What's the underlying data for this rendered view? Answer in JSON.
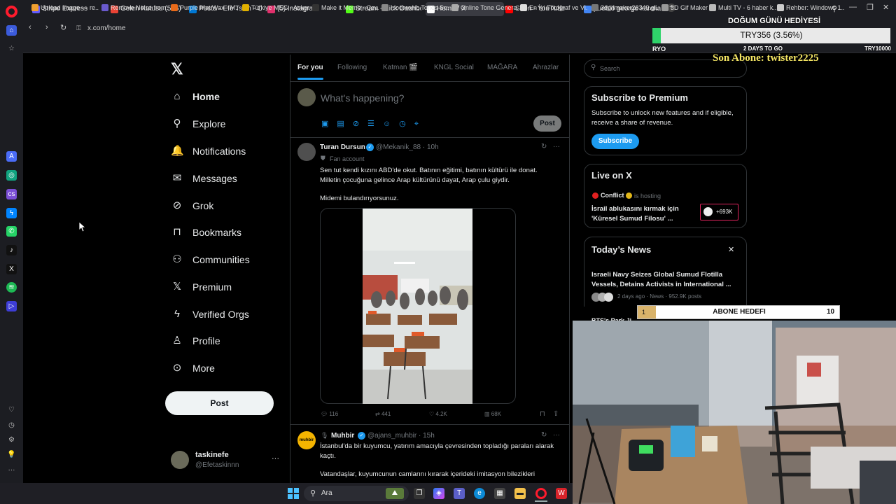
{
  "browser": {
    "tabs": [
      {
        "label": "Stripe Express",
        "icon": "stripe-icon",
        "color": "#635bff"
      },
      {
        "label": "Gelen Kutusu (516) - nosu",
        "icon": "gmail-icon",
        "color": "#ea4335"
      },
      {
        "label": "Posta - Efe Tskin - Outlook",
        "icon": "outlook-icon",
        "color": "#0078d4"
      },
      {
        "label": "(5) Instagram",
        "icon": "instagram-icon",
        "color": "#e1306c"
      },
      {
        "label": "Stream - Kick Dashboard",
        "icon": "kick-icon",
        "color": "#53fc18"
      },
      {
        "label": "Home / X",
        "icon": "x-icon",
        "color": "#ffffff"
      },
      {
        "label": "Siren - YouTube",
        "icon": "youtube-icon",
        "color": "#ff0000"
      },
      {
        "label": "pueblo george karelias - G",
        "icon": "google-icon",
        "color": "#4285f4"
      }
    ],
    "new_tab": "+",
    "url": "x.com/home",
    "bookmarks": [
      {
        "label": "Upload Image — re...",
        "color": "#f0a030"
      },
      {
        "label": "Remove Noise from...",
        "color": "#6a5acd"
      },
      {
        "label": "Purple Mat Wax - M...",
        "color": "#e86a1a"
      },
      {
        "label": "Türkiye MEG - Asker...",
        "color": "#e0b000"
      },
      {
        "label": "Make it Meme - Çev...",
        "color": "#333333"
      },
      {
        "label": "Isochronic Tones So...",
        "color": "#888888"
      },
      {
        "label": "Online Tone Genera...",
        "color": "#aaaaaa"
      },
      {
        "label": "En İyi Fotoğraf ve Vi...",
        "color": "#dddddd"
      },
      {
        "label": "3dgifmaker28349.gi...",
        "color": "#777777"
      },
      {
        "label": "3D Gif Maker",
        "color": "#999999"
      },
      {
        "label": "Multi TV - 6 haber k...",
        "color": "#bbbbbb"
      },
      {
        "label": "Rehber: Windows 1...",
        "color": "#cccccc"
      }
    ]
  },
  "x_nav": {
    "items": [
      {
        "label": "Home",
        "icon": "home-icon",
        "glyph": "⌂",
        "bold": true
      },
      {
        "label": "Explore",
        "icon": "search-icon",
        "glyph": "⚲"
      },
      {
        "label": "Notifications",
        "icon": "bell-icon",
        "glyph": "🔔"
      },
      {
        "label": "Messages",
        "icon": "mail-icon",
        "glyph": "✉"
      },
      {
        "label": "Grok",
        "icon": "grok-icon",
        "glyph": "⊘"
      },
      {
        "label": "Bookmarks",
        "icon": "bookmark-icon",
        "glyph": "⊓"
      },
      {
        "label": "Communities",
        "icon": "communities-icon",
        "glyph": "⚇"
      },
      {
        "label": "Premium",
        "icon": "x-premium-icon",
        "glyph": "𝕏"
      },
      {
        "label": "Verified Orgs",
        "icon": "lightning-icon",
        "glyph": "ϟ"
      },
      {
        "label": "Profile",
        "icon": "person-icon",
        "glyph": "♙"
      },
      {
        "label": "More",
        "icon": "more-circle-icon",
        "glyph": "⊙"
      }
    ],
    "post_label": "Post",
    "account": {
      "name": "taskinefe",
      "handle": "@Efetaskinnn"
    }
  },
  "feed": {
    "tabs": [
      "For you",
      "Following",
      "Katman 🎬",
      "KNGL Social",
      "MAĞARA",
      "Ahrazlar"
    ],
    "compose_placeholder": "What's happening?",
    "compose_post": "Post",
    "tweets": [
      {
        "name": "Turan Dursun",
        "handle": "@Mekanik_88 · 10h",
        "badge": "Fan account",
        "text1": "Sen tut kendi kızını ABD'de okut. Batının eğitimi, batının kültürü ile donat. Milletin çocuğuna gelince Arap kültürünü dayat, Arap çulu giydir.",
        "text2": "Midemi bulandırıyorsunuz.",
        "replies": "116",
        "reposts": "441",
        "likes": "4.2K",
        "views": "68K"
      },
      {
        "name": "Muhbir",
        "handle": "@ajans_muhbir · 15h",
        "avatar_text": "muhbir",
        "text1": "İstanbul'da bir kuyumcu, yatırım amacıyla çevresinden topladığı paraları alarak kaçtı.",
        "text2": "Vatandaşlar, kuyumcunun camlarını kırarak içerideki imitasyon bilezikleri"
      }
    ]
  },
  "right": {
    "search_placeholder": "Search",
    "premium": {
      "title": "Subscribe to Premium",
      "body": "Subscribe to unlock new features and if eligible, receive a share of revenue.",
      "button": "Subscribe"
    },
    "live": {
      "title": "Live on X",
      "host": "Conflict",
      "status": "is hosting",
      "headline": "İsrail ablukasını kırmak için 'Küresel Sumud Filosu' ...",
      "count": "+693K"
    },
    "news": {
      "title": "Today’s News",
      "headline": "Israeli Navy Seizes Global Sumud Flotilla Vessels, Detains Activists in International ...",
      "meta": "2 days ago · News · 952.9K posts",
      "partial": "BTS's Park Ji..."
    }
  },
  "overlays": {
    "dogum_title": "DOĞUM GÜNÜ HEDİYESİ",
    "dogum_amount": "TRY356 (3.56%)",
    "dogum_left": "RYO",
    "dogum_days": "2 DAYS TO GO",
    "dogum_target": "TRY10000",
    "dogum_progress": 0.0356,
    "son_abone": "Son Abone: twister2225",
    "abone_num": "1",
    "abone_title": "ABONE HEDEFI",
    "abone_goal": "10"
  },
  "taskbar": {
    "search_label": "Ara"
  },
  "colors": {
    "x_blue": "#1d9bf0",
    "green_overlay": "#62d44a",
    "son_abone": "#f5e663"
  }
}
